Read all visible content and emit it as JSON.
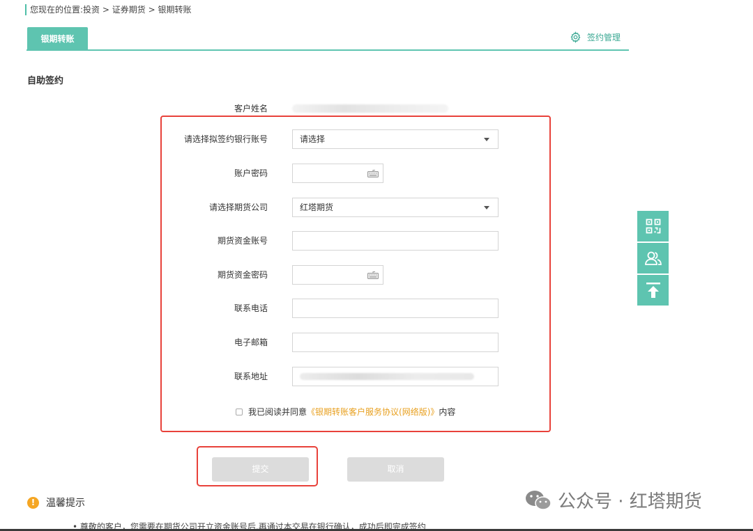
{
  "breadcrumb": {
    "prefix": "您现在的位置:",
    "items": [
      "投资",
      "证券期货",
      "银期转账"
    ],
    "separator": " > "
  },
  "tabs": {
    "active": "银期转账",
    "sign_management": "签约管理"
  },
  "section_title": "自助签约",
  "form": {
    "customer_name_label": "客户姓名",
    "bank_account_label": "请选择拟签约银行账号",
    "bank_account_value": "请选择",
    "account_password_label": "账户密码",
    "futures_company_label": "请选择期货公司",
    "futures_company_value": "红塔期货",
    "futures_account_label": "期货资金账号",
    "futures_password_label": "期货资金密码",
    "phone_label": "联系电话",
    "email_label": "电子邮箱",
    "address_label": "联系地址",
    "agree_prefix": "我已阅读并同意",
    "agree_link": "《银期转账客户服务协议(网络版)》",
    "agree_suffix": "内容"
  },
  "buttons": {
    "submit": "提交",
    "cancel": "取消"
  },
  "tips": {
    "title": "温馨提示",
    "line1": "• 尊敬的客户，您需要在期货公司开立资金账号后,再通过本交易在银行确认，成功后即完成签约"
  },
  "watermark": "公众号 · 红塔期货",
  "colors": {
    "accent": "#5ec4b0",
    "highlight_border": "#e8413a",
    "link": "#e8a020",
    "warning": "#f5a623"
  },
  "icons": {
    "sign_management": "gear-icon",
    "keyboard": "keyboard-icon",
    "qr": "qr-code-icon",
    "service": "customer-service-icon",
    "top": "back-to-top-icon",
    "tips": "warning-icon",
    "wechat": "wechat-icon"
  }
}
